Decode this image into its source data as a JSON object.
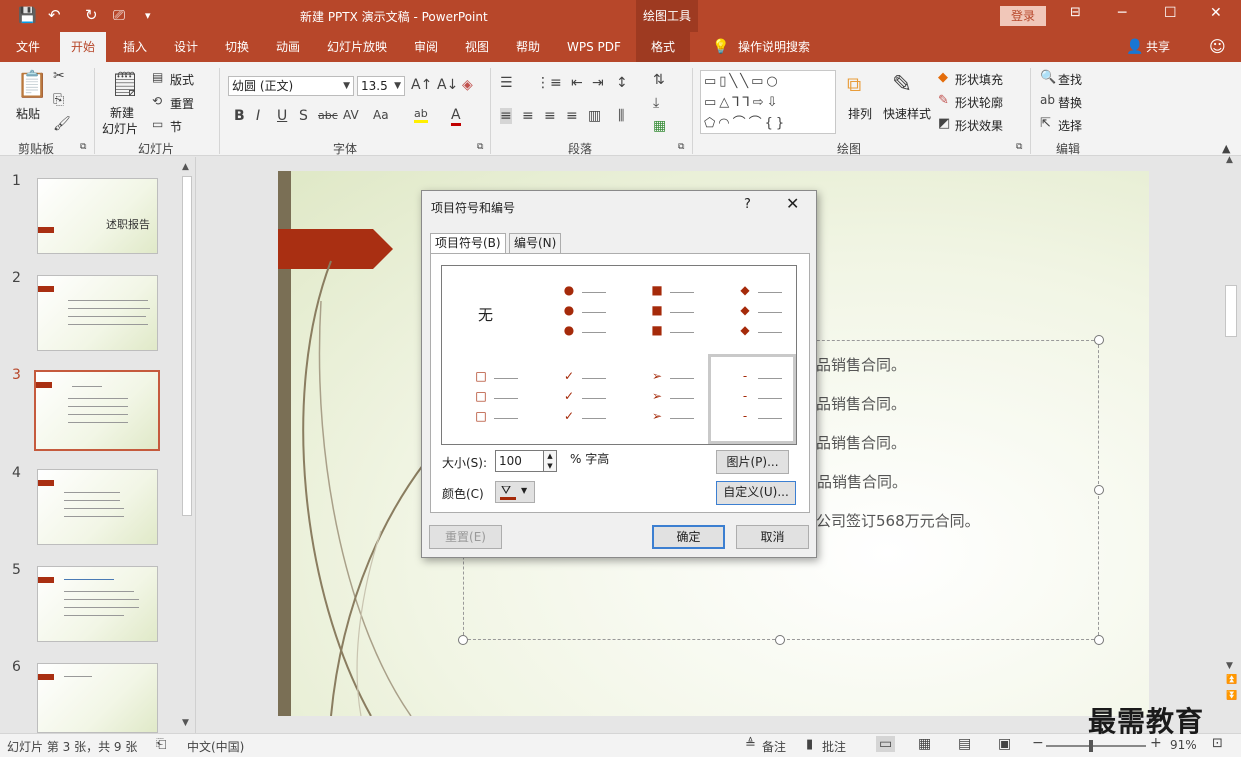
{
  "titlebar": {
    "doc_title": "新建 PPTX 演示文稿  -  PowerPoint",
    "drawing_tools": "绘图工具",
    "login": "登录",
    "minimize": "─",
    "restore": "☐",
    "close": "✕",
    "qa_dropdown": "▾"
  },
  "tabs": [
    "文件",
    "开始",
    "插入",
    "设计",
    "切换",
    "动画",
    "幻灯片放映",
    "审阅",
    "视图",
    "帮助",
    "WPS PDF",
    "格式"
  ],
  "tell_me": "操作说明搜索",
  "share": "共享",
  "ribbon": {
    "clipboard": {
      "paste": "粘贴",
      "label": "剪贴板"
    },
    "slides": {
      "new_slide_line1": "新建",
      "new_slide_line2": "幻灯片",
      "layout": "版式",
      "reset": "重置",
      "section": "节",
      "label": "幻灯片"
    },
    "font": {
      "font_name": "幼圆 (正文)",
      "font_size": "13.5",
      "label": "字体"
    },
    "paragraph": {
      "label": "段落"
    },
    "drawing": {
      "arrange": "排列",
      "quick_styles": "快速样式",
      "shape_fill": "形状填充",
      "shape_outline": "形状轮廓",
      "shape_effects": "形状效果",
      "label": "绘图"
    },
    "editing": {
      "find": "查找",
      "replace": "替换",
      "select": "选择",
      "label": "编辑"
    }
  },
  "thumbnails": [
    {
      "num": "1",
      "title": "述职报告"
    },
    {
      "num": "2",
      "title": ""
    },
    {
      "num": "3",
      "title": ""
    },
    {
      "num": "4",
      "title": ""
    },
    {
      "num": "5",
      "title": ""
    },
    {
      "num": "6",
      "title": ""
    }
  ],
  "slide": {
    "lines": [
      "品销售合同。",
      "品销售合同。",
      "品销售合同。",
      "产品销售合同。",
      "公司签订568万元合同。"
    ]
  },
  "dialog": {
    "title": "项目符号和编号",
    "help": "?",
    "close": "✕",
    "tab_bullets": "项目符号(B)",
    "tab_numbering": "编号(N)",
    "none_label": "无",
    "size_label": "大小(S):",
    "size_value": "100",
    "size_unit": "% 字高",
    "color_label": "颜色(C)",
    "picture_button": "图片(P)...",
    "customize_button": "自定义(U)...",
    "reset_button": "重置(E)",
    "ok_button": "确定",
    "cancel_button": "取消"
  },
  "statusbar": {
    "slide_info": "幻灯片 第 3 张，共 9 张",
    "language": "中文(中国)",
    "notes": "备注",
    "comments": "批注",
    "zoom": "91%"
  },
  "watermark": "最需教育",
  "colors": {
    "accent": "#b7472a",
    "bullet": "#a52a0a",
    "selection": "#c55a3d"
  }
}
